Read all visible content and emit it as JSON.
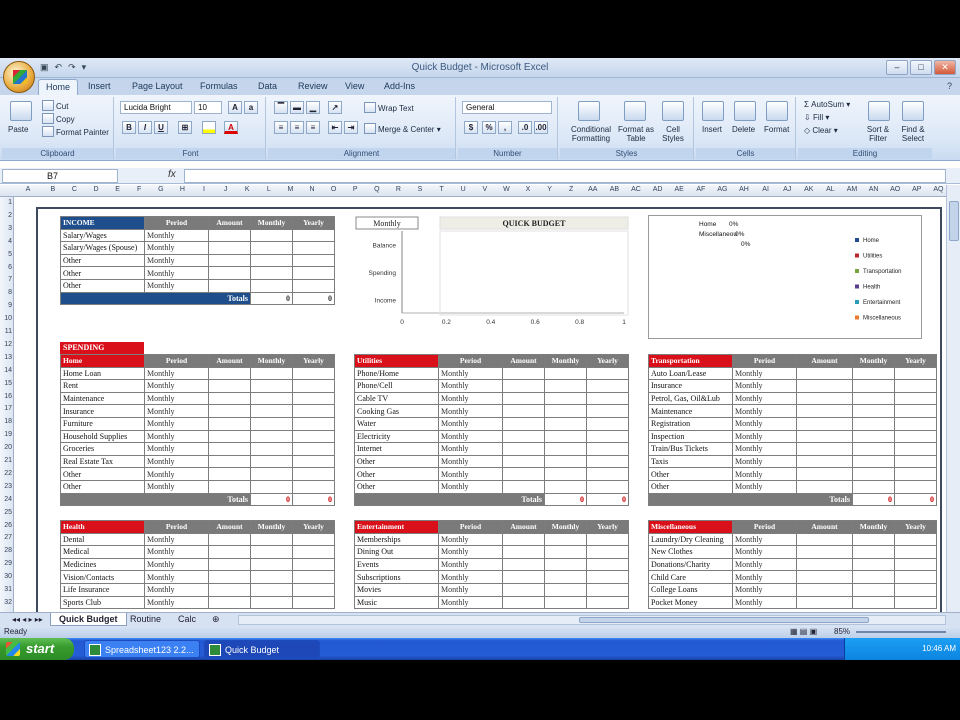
{
  "window": {
    "title": "Quick Budget - Microsoft Excel"
  },
  "tabs": [
    "Home",
    "Insert",
    "Page Layout",
    "Formulas",
    "Data",
    "Review",
    "View",
    "Add-Ins"
  ],
  "ribbon": {
    "clipboard": {
      "paste": "Paste",
      "cut": "Cut",
      "copy": "Copy",
      "format_painter": "Format Painter",
      "label": "Clipboard"
    },
    "font": {
      "name": "Lucida Bright",
      "size": "10",
      "label": "Font"
    },
    "alignment": {
      "wrap_text": "Wrap Text",
      "merge_center": "Merge & Center",
      "label": "Alignment"
    },
    "number": {
      "format": "General",
      "currency": "$",
      "percent": "%",
      "comma": ",",
      "label": "Number"
    },
    "styles": {
      "conditional": "Conditional Formatting",
      "format_table": "Format as Table",
      "cell_styles": "Cell Styles",
      "label": "Styles"
    },
    "cells": {
      "insert": "Insert",
      "delete": "Delete",
      "format": "Format",
      "label": "Cells"
    },
    "editing": {
      "autosum": "AutoSum",
      "fill": "Fill",
      "clear": "Clear",
      "sort": "Sort & Filter",
      "find": "Find & Select",
      "label": "Editing"
    }
  },
  "formula_bar": {
    "name_box": "B7",
    "fx": "fx",
    "value": ""
  },
  "columns": [
    "A",
    "B",
    "C",
    "D",
    "E",
    "F",
    "G",
    "H",
    "I",
    "J",
    "K",
    "L",
    "M",
    "N",
    "O",
    "P",
    "Q",
    "R",
    "S",
    "T",
    "U",
    "V",
    "W",
    "X",
    "Y",
    "Z",
    "AA",
    "AB",
    "AC",
    "AD",
    "AE",
    "AF",
    "AG",
    "AH",
    "AI",
    "AJ",
    "AK",
    "AL",
    "AM",
    "AN",
    "AO",
    "AP",
    "AQ"
  ],
  "rows": [
    "1",
    "2",
    "3",
    "4",
    "5",
    "6",
    "7",
    "8",
    "9",
    "10",
    "11",
    "12",
    "13",
    "14",
    "15",
    "16",
    "17",
    "18",
    "19",
    "20",
    "21",
    "22",
    "23",
    "24",
    "25",
    "26",
    "27",
    "28",
    "29",
    "30",
    "31",
    "32"
  ],
  "headers": {
    "period": "Period",
    "amount": "Amount",
    "monthly": "Monthly",
    "yearly": "Yearly",
    "totals": "Totals",
    "monthly_val": "Monthly"
  },
  "income": {
    "title": "INCOME",
    "items": [
      "Salary/Wages",
      "Salary/Wages (Spouse)",
      "Other",
      "Other",
      "Other"
    ],
    "monthly_total": "0",
    "yearly_total": "0"
  },
  "spending_label": "SPENDING",
  "sections": [
    {
      "title": "Home",
      "items": [
        "Home Loan",
        "Rent",
        "Maintenance",
        "Insurance",
        "Furniture",
        "Household Supplies",
        "Groceries",
        "Real Estate Tax",
        "Other",
        "Other"
      ],
      "monthly_total": "0",
      "yearly_total": "0"
    },
    {
      "title": "Utilities",
      "items": [
        "Phone/Home",
        "Phone/Cell",
        "Cable TV",
        "Cooking Gas",
        "Water",
        "Electricity",
        "Internet",
        "Other",
        "Other",
        "Other"
      ],
      "monthly_total": "0",
      "yearly_total": "0"
    },
    {
      "title": "Transportation",
      "items": [
        "Auto Loan/Lease",
        "Insurance",
        "Petrol, Gas, Oil&Lub",
        "Maintenance",
        "Registration",
        "Inspection",
        "Train/Bus Tickets",
        "Taxis",
        "Other",
        "Other"
      ],
      "monthly_total": "0",
      "yearly_total": "0"
    },
    {
      "title": "Health",
      "items": [
        "Dental",
        "Medical",
        "Medicines",
        "Vision/Contacts",
        "Life Insurance",
        "Sports Club"
      ]
    },
    {
      "title": "Entertainment",
      "items": [
        "Memberships",
        "Dining Out",
        "Events",
        "Subscriptions",
        "Movies",
        "Music"
      ]
    },
    {
      "title": "Miscellaneous",
      "items": [
        "Laundry/Dry Cleaning",
        "New Clothes",
        "Donations/Charity",
        "Child Care",
        "College Loans",
        "Pocket Money"
      ]
    }
  ],
  "chart_data": [
    {
      "type": "bar",
      "title": "QUICK BUDGET",
      "selector_value": "Monthly",
      "categories": [
        "Balance",
        "Spending",
        "Income"
      ],
      "values": [
        0,
        0,
        0
      ],
      "xlim": [
        0,
        1
      ],
      "x_ticks": [
        "0",
        "0.2",
        "0.4",
        "0.6",
        "0.8",
        "1"
      ],
      "orientation": "horizontal"
    },
    {
      "type": "pie",
      "labels": [
        "Home",
        "Utilities",
        "Transportation",
        "Health",
        "Entertainment",
        "Miscellaneous"
      ],
      "colors": [
        "#1f4e8c",
        "#b8282b",
        "#7aa33a",
        "#5b3c8c",
        "#2a9bb8",
        "#e77a2c"
      ],
      "visible_labels": [
        "Home",
        "0%",
        "Miscellaneou",
        "0%",
        "0%"
      ],
      "legend": "right"
    }
  ],
  "sheet_tabs": [
    "Quick Budget",
    "Routine",
    "Calc"
  ],
  "status": {
    "ready": "Ready",
    "zoom": "85%"
  },
  "taskbar": {
    "start": "start",
    "task1": "Spreadsheet123 2.2...",
    "task2": "Quick Budget",
    "clock": "10:46 AM"
  }
}
